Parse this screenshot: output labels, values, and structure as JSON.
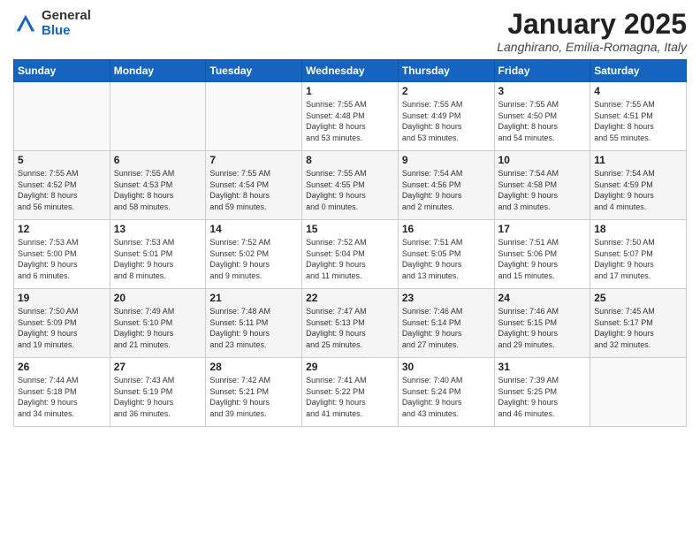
{
  "logo": {
    "general": "General",
    "blue": "Blue"
  },
  "header": {
    "month": "January 2025",
    "location": "Langhirano, Emilia-Romagna, Italy"
  },
  "weekdays": [
    "Sunday",
    "Monday",
    "Tuesday",
    "Wednesday",
    "Thursday",
    "Friday",
    "Saturday"
  ],
  "weeks": [
    [
      {
        "day": "",
        "info": ""
      },
      {
        "day": "",
        "info": ""
      },
      {
        "day": "",
        "info": ""
      },
      {
        "day": "1",
        "info": "Sunrise: 7:55 AM\nSunset: 4:48 PM\nDaylight: 8 hours\nand 53 minutes."
      },
      {
        "day": "2",
        "info": "Sunrise: 7:55 AM\nSunset: 4:49 PM\nDaylight: 8 hours\nand 53 minutes."
      },
      {
        "day": "3",
        "info": "Sunrise: 7:55 AM\nSunset: 4:50 PM\nDaylight: 8 hours\nand 54 minutes."
      },
      {
        "day": "4",
        "info": "Sunrise: 7:55 AM\nSunset: 4:51 PM\nDaylight: 8 hours\nand 55 minutes."
      }
    ],
    [
      {
        "day": "5",
        "info": "Sunrise: 7:55 AM\nSunset: 4:52 PM\nDaylight: 8 hours\nand 56 minutes."
      },
      {
        "day": "6",
        "info": "Sunrise: 7:55 AM\nSunset: 4:53 PM\nDaylight: 8 hours\nand 58 minutes."
      },
      {
        "day": "7",
        "info": "Sunrise: 7:55 AM\nSunset: 4:54 PM\nDaylight: 8 hours\nand 59 minutes."
      },
      {
        "day": "8",
        "info": "Sunrise: 7:55 AM\nSunset: 4:55 PM\nDaylight: 9 hours\nand 0 minutes."
      },
      {
        "day": "9",
        "info": "Sunrise: 7:54 AM\nSunset: 4:56 PM\nDaylight: 9 hours\nand 2 minutes."
      },
      {
        "day": "10",
        "info": "Sunrise: 7:54 AM\nSunset: 4:58 PM\nDaylight: 9 hours\nand 3 minutes."
      },
      {
        "day": "11",
        "info": "Sunrise: 7:54 AM\nSunset: 4:59 PM\nDaylight: 9 hours\nand 4 minutes."
      }
    ],
    [
      {
        "day": "12",
        "info": "Sunrise: 7:53 AM\nSunset: 5:00 PM\nDaylight: 9 hours\nand 6 minutes."
      },
      {
        "day": "13",
        "info": "Sunrise: 7:53 AM\nSunset: 5:01 PM\nDaylight: 9 hours\nand 8 minutes."
      },
      {
        "day": "14",
        "info": "Sunrise: 7:52 AM\nSunset: 5:02 PM\nDaylight: 9 hours\nand 9 minutes."
      },
      {
        "day": "15",
        "info": "Sunrise: 7:52 AM\nSunset: 5:04 PM\nDaylight: 9 hours\nand 11 minutes."
      },
      {
        "day": "16",
        "info": "Sunrise: 7:51 AM\nSunset: 5:05 PM\nDaylight: 9 hours\nand 13 minutes."
      },
      {
        "day": "17",
        "info": "Sunrise: 7:51 AM\nSunset: 5:06 PM\nDaylight: 9 hours\nand 15 minutes."
      },
      {
        "day": "18",
        "info": "Sunrise: 7:50 AM\nSunset: 5:07 PM\nDaylight: 9 hours\nand 17 minutes."
      }
    ],
    [
      {
        "day": "19",
        "info": "Sunrise: 7:50 AM\nSunset: 5:09 PM\nDaylight: 9 hours\nand 19 minutes."
      },
      {
        "day": "20",
        "info": "Sunrise: 7:49 AM\nSunset: 5:10 PM\nDaylight: 9 hours\nand 21 minutes."
      },
      {
        "day": "21",
        "info": "Sunrise: 7:48 AM\nSunset: 5:11 PM\nDaylight: 9 hours\nand 23 minutes."
      },
      {
        "day": "22",
        "info": "Sunrise: 7:47 AM\nSunset: 5:13 PM\nDaylight: 9 hours\nand 25 minutes."
      },
      {
        "day": "23",
        "info": "Sunrise: 7:46 AM\nSunset: 5:14 PM\nDaylight: 9 hours\nand 27 minutes."
      },
      {
        "day": "24",
        "info": "Sunrise: 7:46 AM\nSunset: 5:15 PM\nDaylight: 9 hours\nand 29 minutes."
      },
      {
        "day": "25",
        "info": "Sunrise: 7:45 AM\nSunset: 5:17 PM\nDaylight: 9 hours\nand 32 minutes."
      }
    ],
    [
      {
        "day": "26",
        "info": "Sunrise: 7:44 AM\nSunset: 5:18 PM\nDaylight: 9 hours\nand 34 minutes."
      },
      {
        "day": "27",
        "info": "Sunrise: 7:43 AM\nSunset: 5:19 PM\nDaylight: 9 hours\nand 36 minutes."
      },
      {
        "day": "28",
        "info": "Sunrise: 7:42 AM\nSunset: 5:21 PM\nDaylight: 9 hours\nand 39 minutes."
      },
      {
        "day": "29",
        "info": "Sunrise: 7:41 AM\nSunset: 5:22 PM\nDaylight: 9 hours\nand 41 minutes."
      },
      {
        "day": "30",
        "info": "Sunrise: 7:40 AM\nSunset: 5:24 PM\nDaylight: 9 hours\nand 43 minutes."
      },
      {
        "day": "31",
        "info": "Sunrise: 7:39 AM\nSunset: 5:25 PM\nDaylight: 9 hours\nand 46 minutes."
      },
      {
        "day": "",
        "info": ""
      }
    ]
  ]
}
